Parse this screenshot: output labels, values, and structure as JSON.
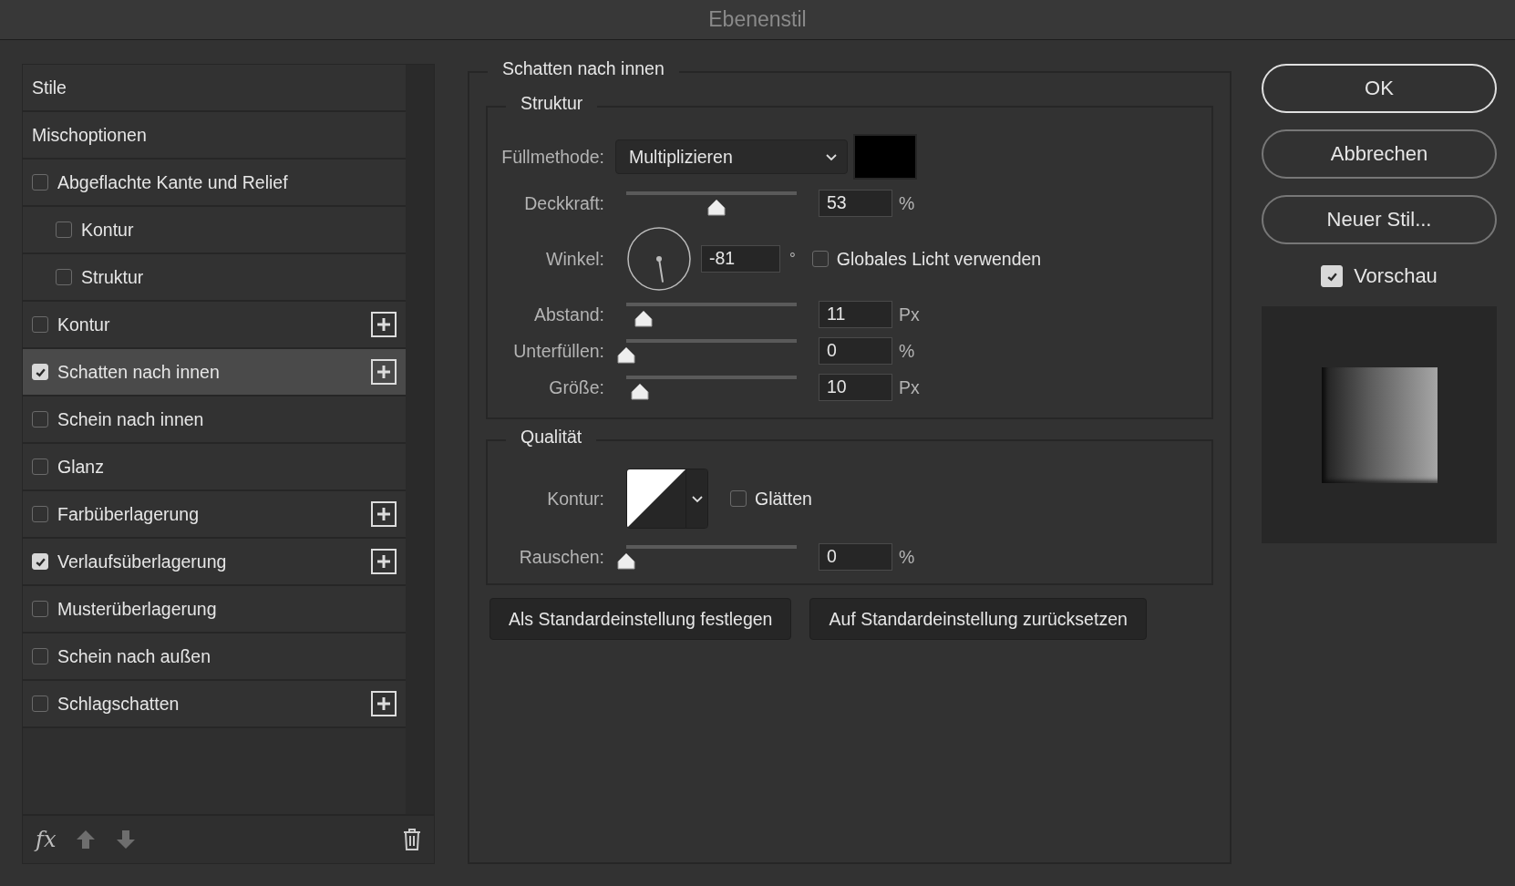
{
  "window": {
    "title": "Ebenenstil"
  },
  "styles_list": {
    "items": [
      {
        "kind": "header",
        "label": "Stile",
        "selected": false
      },
      {
        "kind": "header",
        "label": "Mischoptionen",
        "selected": false
      },
      {
        "kind": "effect",
        "label": "Abgeflachte Kante und Relief",
        "checked": false,
        "selected": false,
        "addable": false,
        "children": [
          {
            "kind": "effect",
            "label": "Kontur",
            "checked": false,
            "selected": false,
            "addable": false
          },
          {
            "kind": "effect",
            "label": "Struktur",
            "checked": false,
            "selected": false,
            "addable": false
          }
        ]
      },
      {
        "kind": "effect",
        "label": "Kontur",
        "checked": false,
        "selected": false,
        "addable": true
      },
      {
        "kind": "effect",
        "label": "Schatten nach innen",
        "checked": true,
        "selected": true,
        "addable": true
      },
      {
        "kind": "effect",
        "label": "Schein nach innen",
        "checked": false,
        "selected": false,
        "addable": false
      },
      {
        "kind": "effect",
        "label": "Glanz",
        "checked": false,
        "selected": false,
        "addable": false
      },
      {
        "kind": "effect",
        "label": "Farbüberlagerung",
        "checked": false,
        "selected": false,
        "addable": true
      },
      {
        "kind": "effect",
        "label": "Verlaufsüberlagerung",
        "checked": true,
        "selected": false,
        "addable": true
      },
      {
        "kind": "effect",
        "label": "Musterüberlagerung",
        "checked": false,
        "selected": false,
        "addable": false
      },
      {
        "kind": "effect",
        "label": "Schein nach außen",
        "checked": false,
        "selected": false,
        "addable": false
      },
      {
        "kind": "effect",
        "label": "Schlagschatten",
        "checked": false,
        "selected": false,
        "addable": true
      }
    ],
    "footer": {
      "fx_label": "fx"
    }
  },
  "settings": {
    "title": "Schatten nach innen",
    "structure": {
      "title": "Struktur",
      "blend_mode": {
        "label": "Füllmethode:",
        "value": "Multiplizieren",
        "color": "#000000"
      },
      "opacity": {
        "label": "Deckkraft:",
        "level": 0.53,
        "value": "53",
        "unit": "%"
      },
      "angle": {
        "label": "Winkel:",
        "value": "-81",
        "unit": "°",
        "global_light": {
          "label": "Globales Licht verwenden",
          "checked": false
        }
      },
      "sliders": [
        {
          "label": "Abstand:",
          "level": 0.1,
          "value": "11",
          "unit": "Px"
        },
        {
          "label": "Unterfüllen:",
          "level": 0,
          "value": "0",
          "unit": "%"
        },
        {
          "label": "Größe:",
          "level": 0.08,
          "value": "10",
          "unit": "Px"
        }
      ]
    },
    "quality": {
      "title": "Qualität",
      "contour_label": "Kontur:",
      "smoothing": {
        "label": "Glätten",
        "checked": false
      },
      "noise": {
        "label": "Rauschen:",
        "level": 0,
        "value": "0",
        "unit": "%"
      }
    },
    "buttons": [
      {
        "label": "Als Standardeinstellung festlegen"
      },
      {
        "label": "Auf Standardeinstellung zurücksetzen"
      }
    ]
  },
  "actions": {
    "buttons": [
      {
        "label": "OK",
        "kind": "default"
      },
      {
        "label": "Abbrechen",
        "kind": "normal"
      },
      {
        "label": "Neuer Stil...",
        "kind": "normal"
      }
    ],
    "preview": {
      "label": "Vorschau",
      "checked": true
    }
  }
}
